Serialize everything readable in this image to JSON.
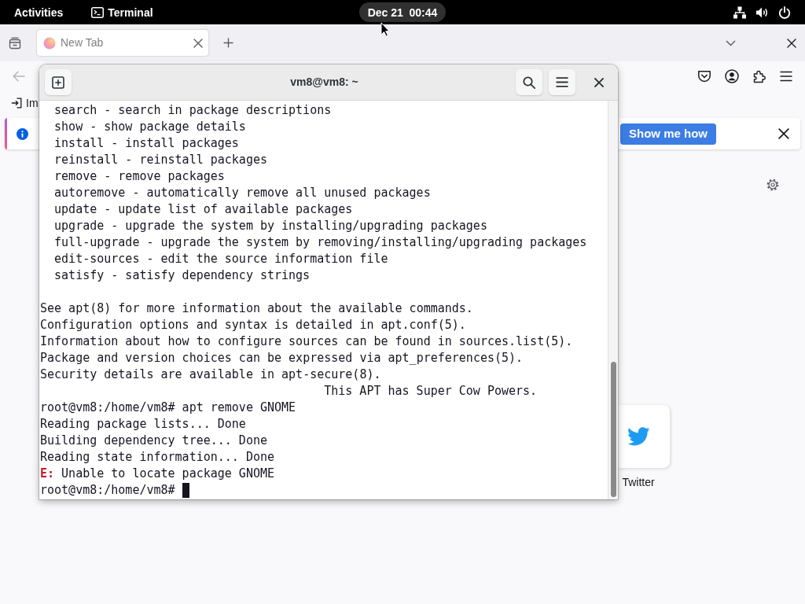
{
  "top_bar": {
    "activities": "Activities",
    "app_menu": "Terminal",
    "clock": "Dec 21  00:44"
  },
  "browser": {
    "tabs": [
      {
        "title": "New Tab",
        "selected": true
      }
    ],
    "bookmarks": [
      {
        "label": "Im"
      }
    ],
    "notification": {
      "button": "Show me how"
    },
    "top_sites": [
      {
        "label": "Twitter"
      }
    ]
  },
  "terminal": {
    "title": "vm8@vm8: ~",
    "lines": [
      {
        "kind": "option",
        "text": "search - search in package descriptions"
      },
      {
        "kind": "option",
        "text": "show - show package details"
      },
      {
        "kind": "option",
        "text": "install - install packages"
      },
      {
        "kind": "option",
        "text": "reinstall - reinstall packages"
      },
      {
        "kind": "option",
        "text": "remove - remove packages"
      },
      {
        "kind": "option",
        "text": "autoremove - automatically remove all unused packages"
      },
      {
        "kind": "option",
        "text": "update - update list of available packages"
      },
      {
        "kind": "option",
        "text": "upgrade - upgrade the system by installing/upgrading packages"
      },
      {
        "kind": "option",
        "text": "full-upgrade - upgrade the system by removing/installing/upgrading packages"
      },
      {
        "kind": "option",
        "text": "edit-sources - edit the source information file"
      },
      {
        "kind": "option",
        "text": "satisfy - satisfy dependency strings"
      },
      {
        "kind": "blank"
      },
      {
        "kind": "output",
        "text": "See apt(8) for more information about the available commands."
      },
      {
        "kind": "output",
        "text": "Configuration options and syntax is detailed in apt.conf(5)."
      },
      {
        "kind": "output",
        "text": "Information about how to configure sources can be found in sources.list(5)."
      },
      {
        "kind": "output",
        "text": "Package and version choices can be expressed via apt_preferences(5)."
      },
      {
        "kind": "output",
        "text": "Security details are available in apt-secure(8)."
      },
      {
        "kind": "banner",
        "text": "This APT has Super Cow Powers."
      },
      {
        "kind": "prompt",
        "text": "root@vm8:/home/vm8# apt remove GNOME",
        "cursor": false
      },
      {
        "kind": "output",
        "text": "Reading package lists... Done"
      },
      {
        "kind": "output",
        "text": "Building dependency tree... Done"
      },
      {
        "kind": "output",
        "text": "Reading state information... Done"
      },
      {
        "kind": "error",
        "text": "**E:** Unable to locate package GNOME"
      },
      {
        "kind": "prompt",
        "text": "root@vm8:/home/vm8#",
        "cursor": true
      }
    ]
  }
}
